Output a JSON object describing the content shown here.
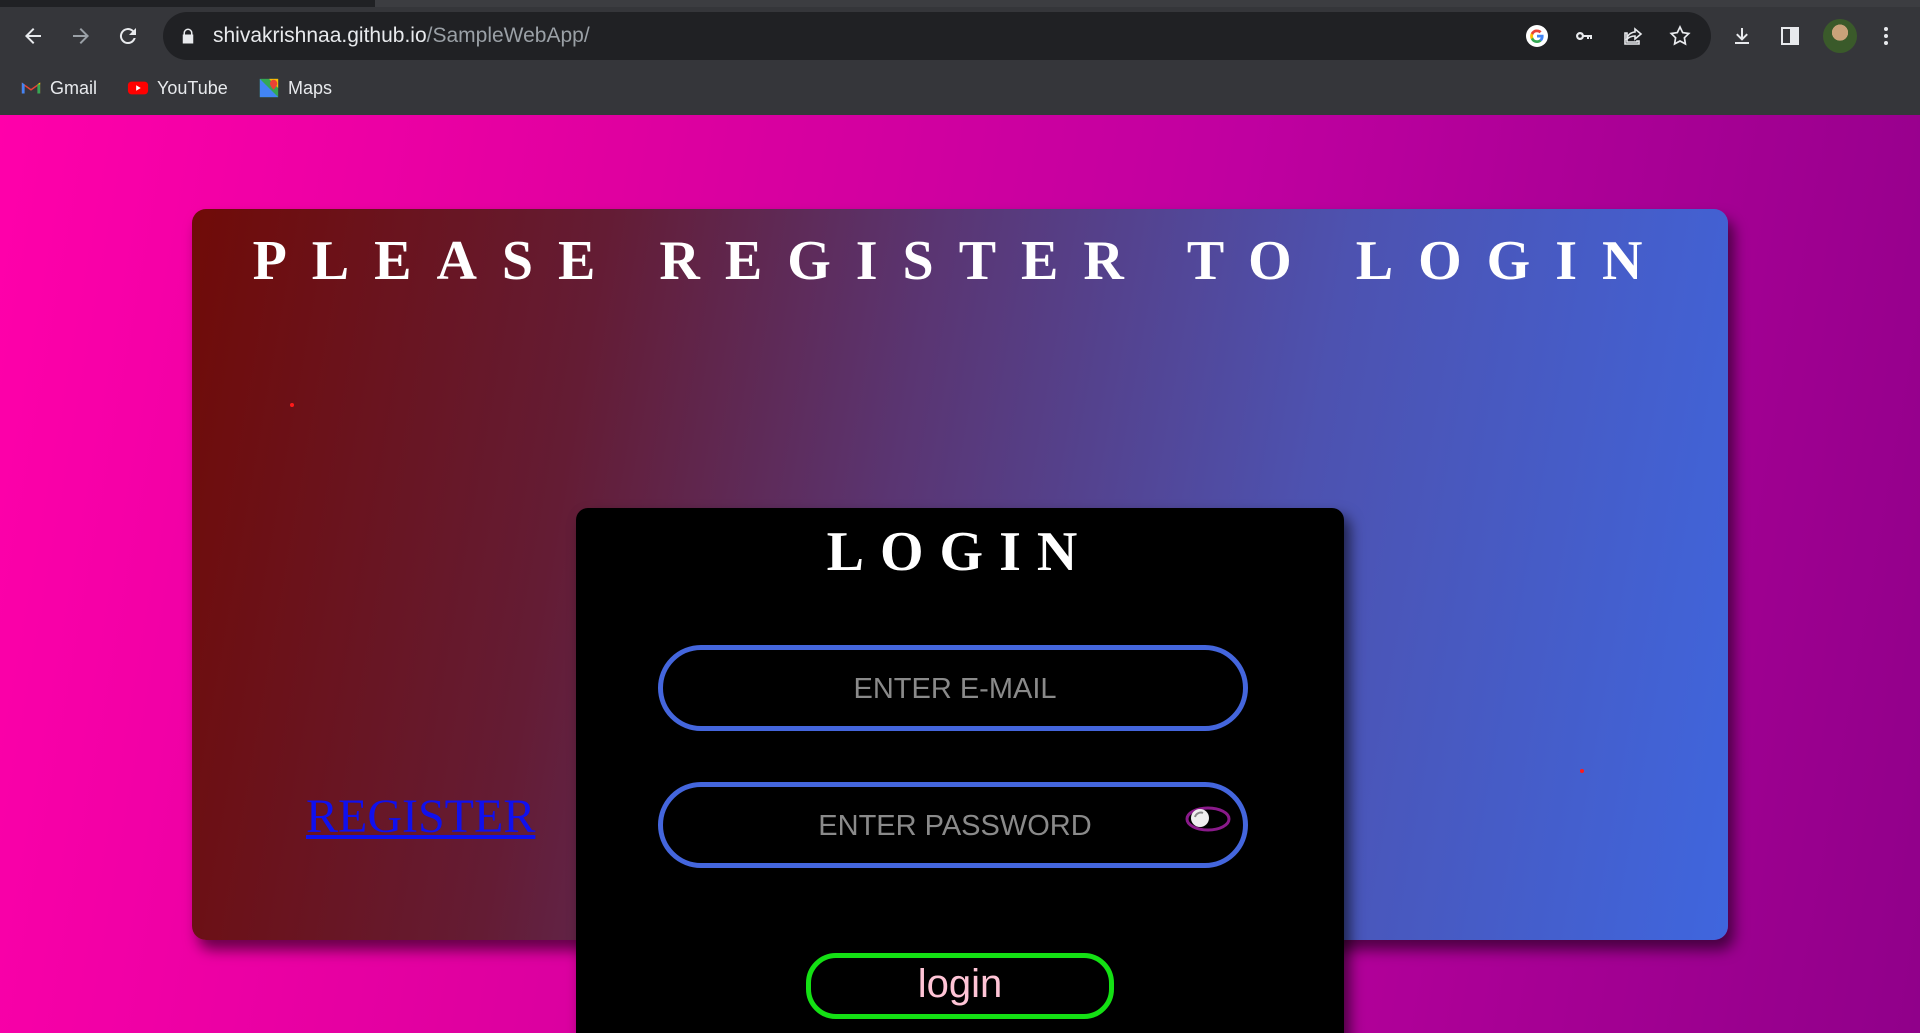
{
  "browser": {
    "url_host": "shivakrishnaa.github.io",
    "url_path": "/SampleWebApp/",
    "bookmarks": [
      {
        "label": "Gmail",
        "icon": "gmail-icon"
      },
      {
        "label": "YouTube",
        "icon": "youtube-icon"
      },
      {
        "label": "Maps",
        "icon": "maps-icon"
      }
    ]
  },
  "page": {
    "banner_title": "PLEASE REGISTER TO LOGIN",
    "register_link": "REGISTER",
    "login_title": "LOGIN",
    "email_placeholder": "ENTER E-MAIL",
    "password_placeholder": "ENTER PASSWORD",
    "login_button": "login"
  },
  "colors": {
    "page_bg_left": "#ff00aa",
    "page_bg_right": "#90008a",
    "banner_left": "#700b08",
    "banner_right": "#3f66de",
    "field_border": "#4466dd",
    "button_border": "#14e014",
    "button_text": "#ffc4d6",
    "link": "#1010ee"
  }
}
